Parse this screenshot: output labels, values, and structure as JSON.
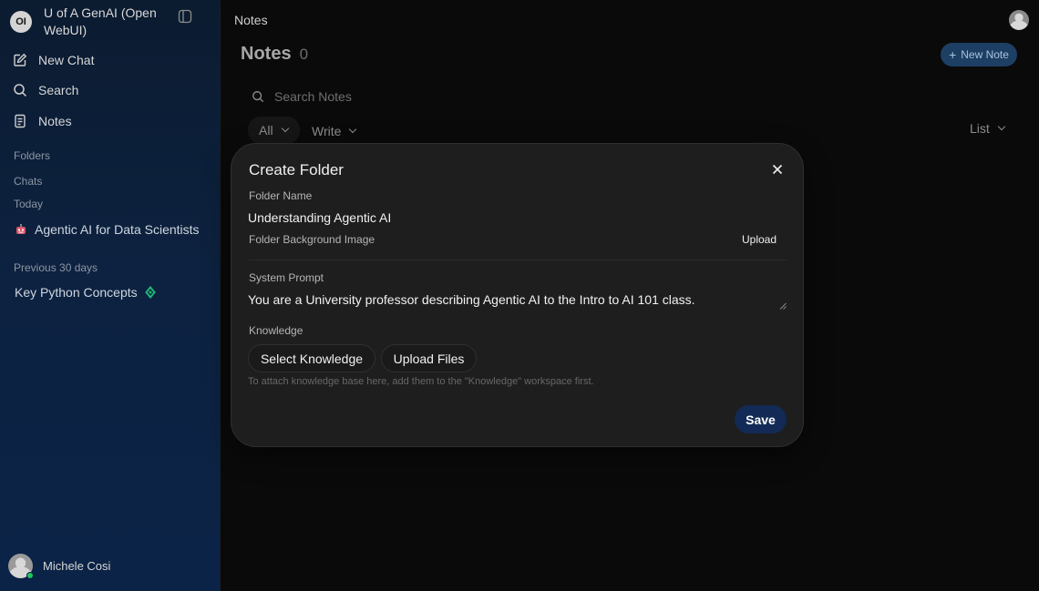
{
  "app": {
    "brand_title": "U of A GenAI (Open WebUI)",
    "logo_text": "OI"
  },
  "sidebar": {
    "nav": [
      {
        "label": "New Chat",
        "icon": "pencil-square-icon"
      },
      {
        "label": "Search",
        "icon": "search-icon"
      },
      {
        "label": "Notes",
        "icon": "notes-icon"
      }
    ],
    "sections": {
      "folders": "Folders",
      "chats": "Chats",
      "today": "Today",
      "previous_30": "Previous 30 days"
    },
    "chats_today": [
      {
        "label": "Agentic AI for Data Scientists",
        "icon": "robot-emoji-icon"
      }
    ],
    "chats_previous": [
      {
        "label": "Key Python Concepts",
        "icon": "recycle-emoji-icon"
      }
    ],
    "user_name": "Michele Cosi"
  },
  "main": {
    "top_title": "Notes",
    "heading": "Notes",
    "count": "0",
    "new_note_label": "New Note",
    "search_placeholder": "Search Notes",
    "filter_all": "All",
    "filter_write": "Write",
    "view_select": "List"
  },
  "modal": {
    "title": "Create Folder",
    "folder_name_label": "Folder Name",
    "folder_name_value": "Understanding Agentic AI",
    "bg_image_label": "Folder Background Image",
    "upload_label": "Upload",
    "system_prompt_label": "System Prompt",
    "system_prompt_value": "You are a University professor describing Agentic AI to the Intro to AI 101 class.",
    "knowledge_label": "Knowledge",
    "select_knowledge_label": "Select Knowledge",
    "upload_files_label": "Upload Files",
    "knowledge_hint": "To attach knowledge base here, add them to the \"Knowledge\" workspace first.",
    "save_label": "Save"
  },
  "colors": {
    "sidebar_top": "#0b1b30",
    "sidebar_bottom": "#0b2347",
    "accent_button": "#122a55",
    "new_note_bg": "#1d3f63",
    "online_status": "#22c55e"
  }
}
